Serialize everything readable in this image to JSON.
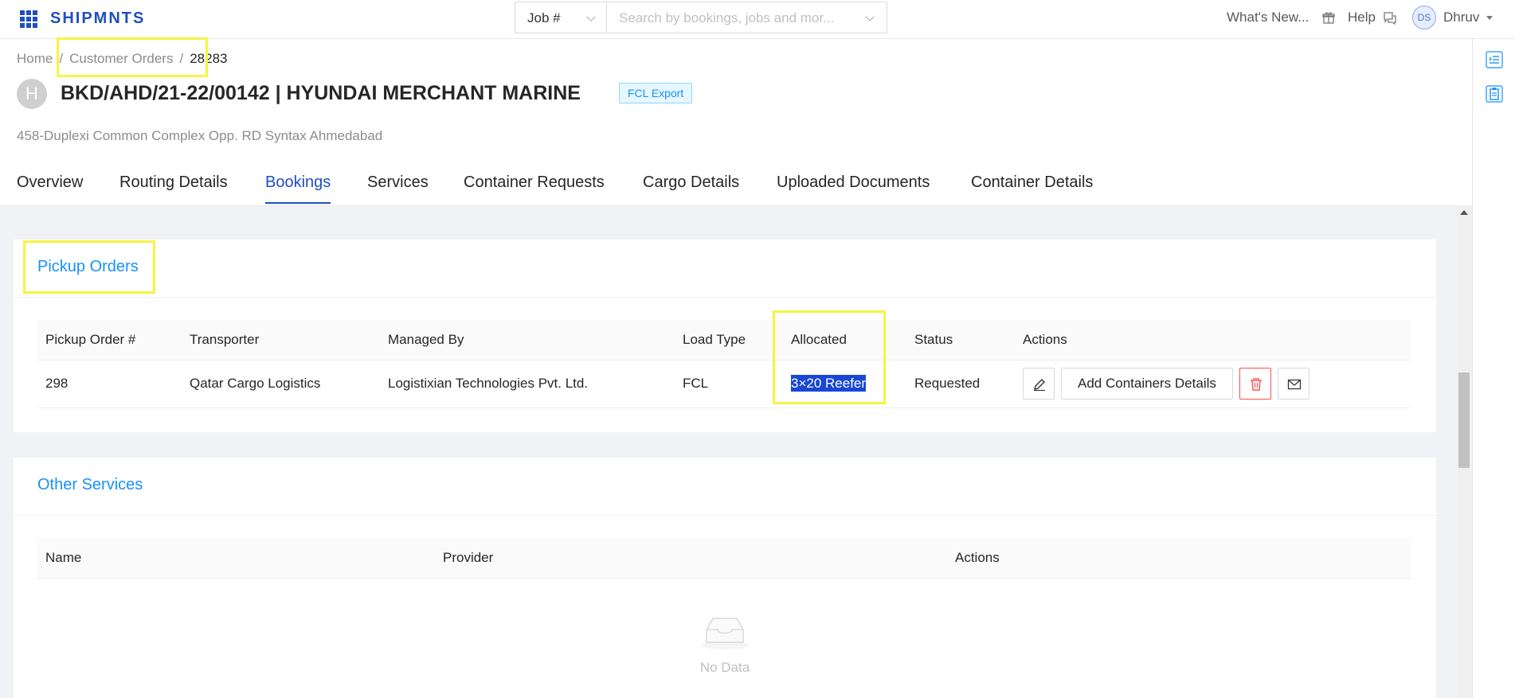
{
  "topbar": {
    "brand": "SHIPMNTS",
    "job_select": "Job #",
    "search_placeholder": "Search by bookings, jobs and mor...",
    "whats_new": "What's New...",
    "help": "Help",
    "user_initials": "DS",
    "user_name": "Dhruv"
  },
  "breadcrumb": {
    "home": "Home",
    "customer_orders": "Customer Orders",
    "current": "28283",
    "separator": "/"
  },
  "header": {
    "avatar_letter": "H",
    "title": "BKD/AHD/21-22/00142 | HYUNDAI MERCHANT MARINE",
    "tag": "FCL Export",
    "address": "458-Duplexi Common Complex Opp. RD Syntax Ahmedabad"
  },
  "tabs": [
    {
      "label": "Overview"
    },
    {
      "label": "Routing Details"
    },
    {
      "label": "Bookings"
    },
    {
      "label": "Services"
    },
    {
      "label": "Container Requests"
    },
    {
      "label": "Cargo Details"
    },
    {
      "label": "Uploaded Documents"
    },
    {
      "label": "Container Details"
    }
  ],
  "active_tab": "Bookings",
  "pickup_orders": {
    "title": "Pickup Orders",
    "columns": [
      "Pickup Order #",
      "Transporter",
      "Managed By",
      "Load Type",
      "Allocated",
      "Status",
      "Actions"
    ],
    "rows": [
      {
        "order_no": "298",
        "transporter": "Qatar Cargo Logistics",
        "managed_by": "Logistixian Technologies Pvt. Ltd.",
        "load_type": "FCL",
        "allocated": "3×20 Reefer",
        "status": "Requested",
        "add_containers_label": "Add Containers Details"
      }
    ]
  },
  "other_services": {
    "title": "Other Services",
    "columns": [
      "Name",
      "Provider",
      "Actions"
    ],
    "empty_text": "No Data"
  },
  "colors": {
    "brand": "#1f4fbf",
    "link": "#1890ff",
    "highlight": "#f5f542",
    "selection": "#1847d6",
    "danger": "#ff4d4f"
  }
}
